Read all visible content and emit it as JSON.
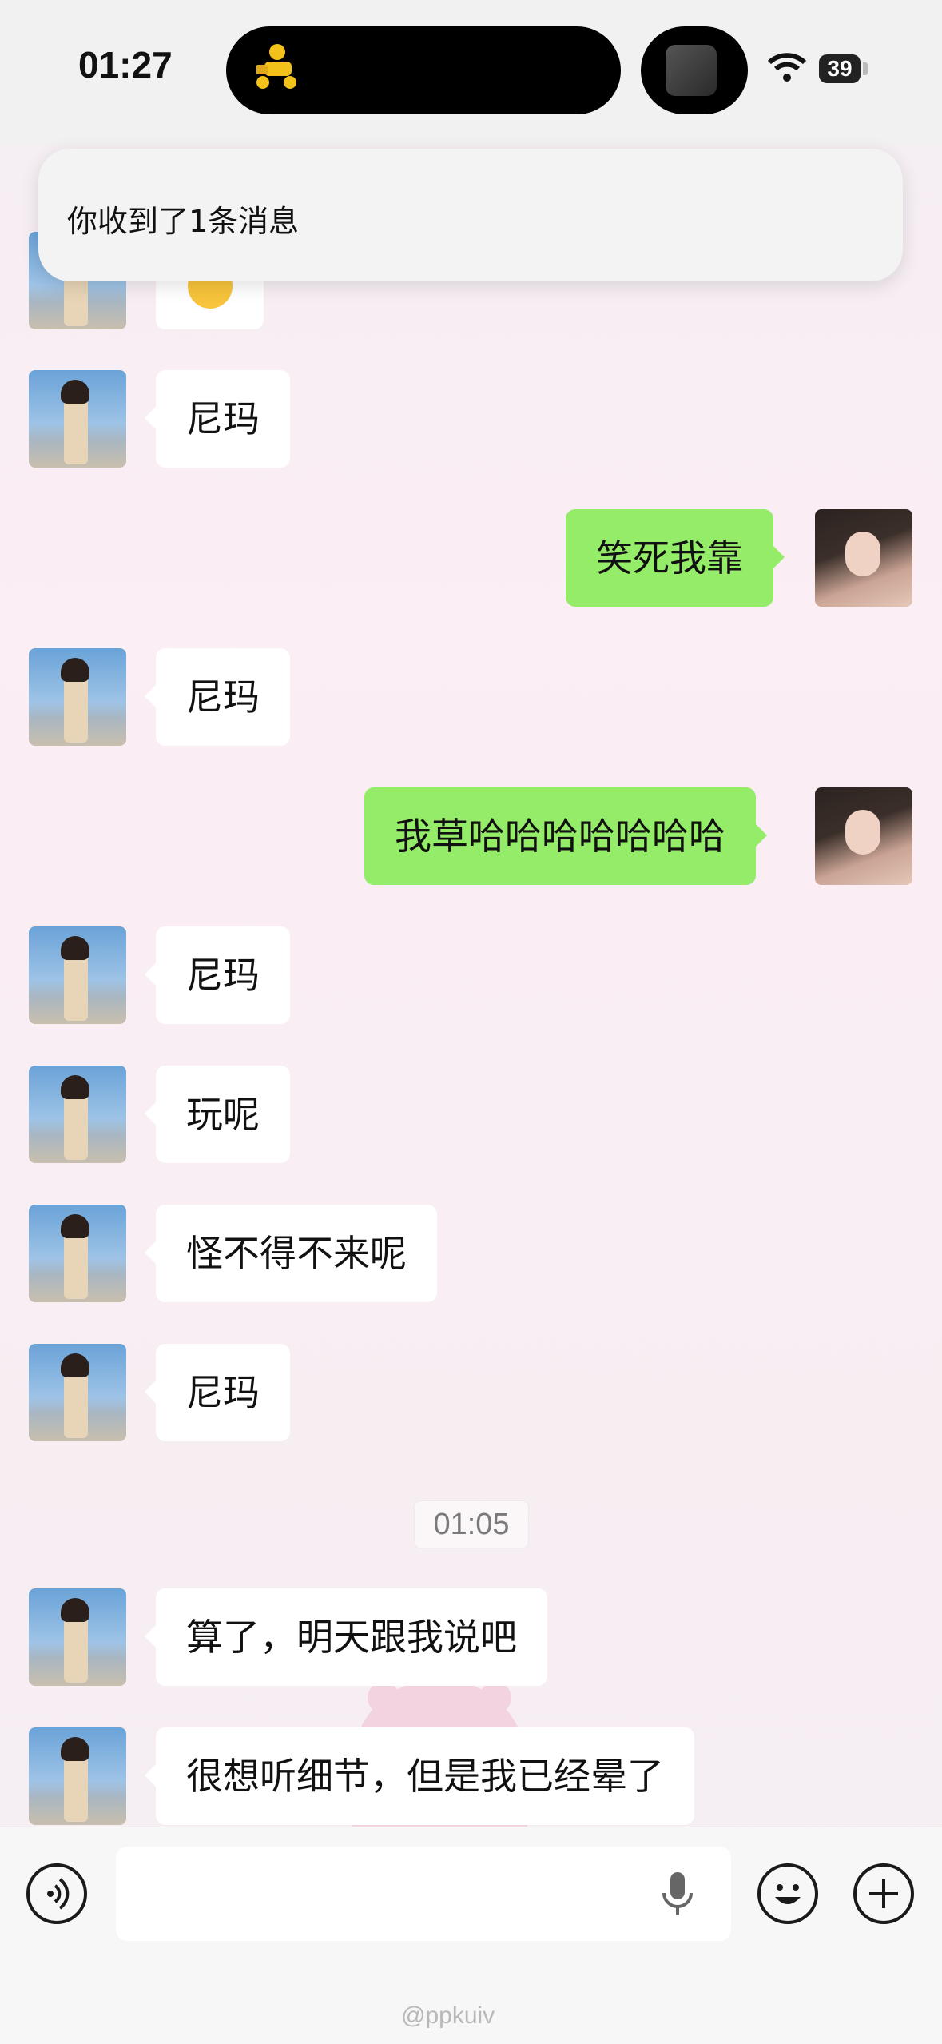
{
  "status_bar": {
    "time": "01:27",
    "battery": "39"
  },
  "notification": {
    "text": "你收到了1条消息"
  },
  "messages": [
    {
      "side": "in",
      "text": "尼玛"
    },
    {
      "side": "out",
      "text": "笑死我靠"
    },
    {
      "side": "in",
      "text": "尼玛"
    },
    {
      "side": "out",
      "text": "我草哈哈哈哈哈哈哈"
    },
    {
      "side": "in",
      "text": "尼玛"
    },
    {
      "side": "in",
      "text": "玩呢"
    },
    {
      "side": "in",
      "text": "怪不得不来呢"
    },
    {
      "side": "in",
      "text": "尼玛"
    },
    {
      "side": "in",
      "text": "算了，明天跟我说吧"
    },
    {
      "side": "in",
      "text": "很想听细节，但是我已经晕了"
    }
  ],
  "timestamp": "01:05",
  "input_bar": {
    "value": "",
    "voice_icon": "voice-icon",
    "emoji_icon": "emoji-icon",
    "plus_icon": "plus-icon",
    "mic_icon": "mic-icon"
  },
  "watermark": "@ppkuiv"
}
